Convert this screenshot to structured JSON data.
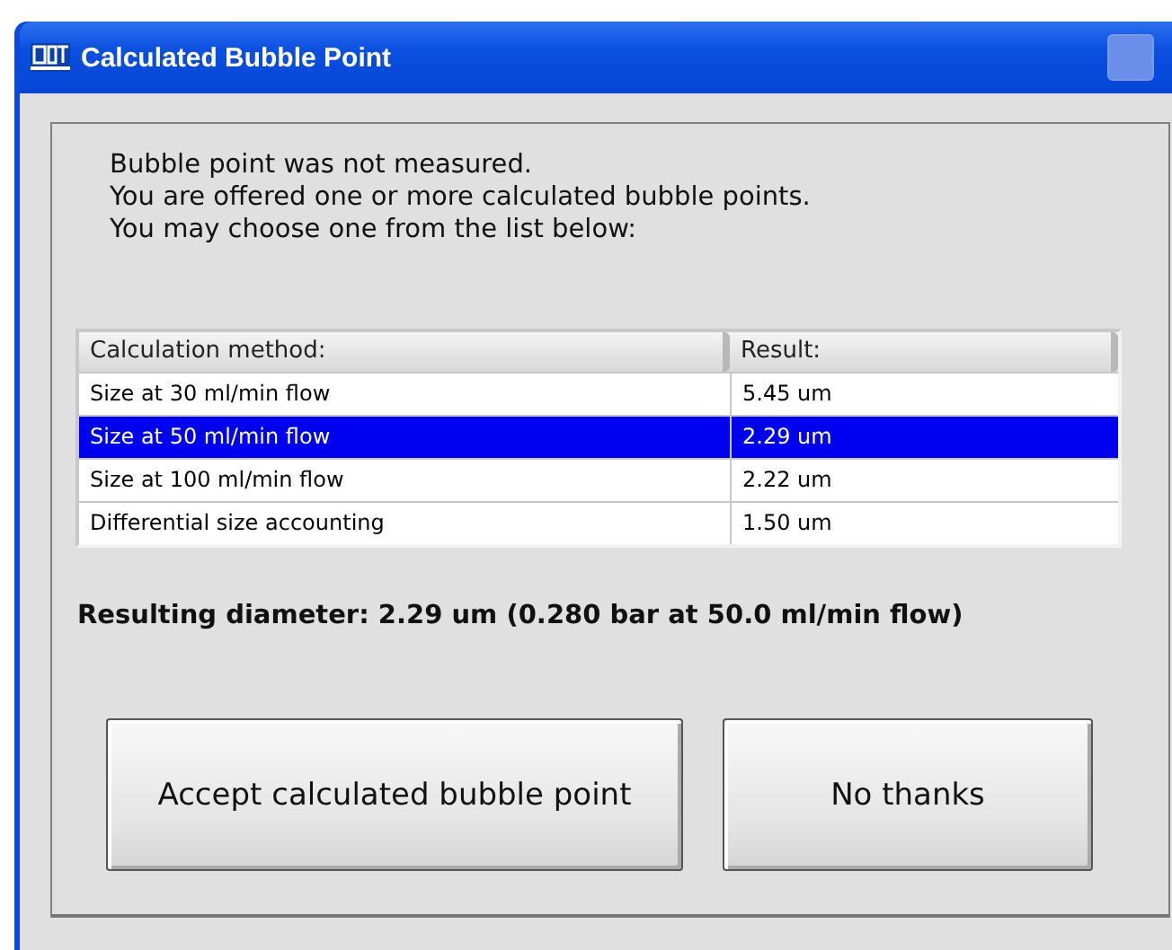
{
  "window": {
    "title": "Calculated Bubble Point"
  },
  "message": [
    "Bubble point was not measured.",
    "You are offered one or more calculated bubble points.",
    "You may choose one from the list below:"
  ],
  "table": {
    "columns": [
      "Calculation method:",
      "Result:"
    ],
    "rows": [
      {
        "method": "Size at 30 ml/min flow",
        "result": "5.45 um",
        "selected": false
      },
      {
        "method": "Size at 50 ml/min flow",
        "result": "2.29 um",
        "selected": true
      },
      {
        "method": "Size at 100 ml/min flow",
        "result": "2.22 um",
        "selected": false
      },
      {
        "method": "Differential size accounting",
        "result": "1.50 um",
        "selected": false
      }
    ]
  },
  "result_text": "Resulting diameter: 2.29 um (0.280 bar at 50.0 ml/min flow)",
  "buttons": [
    "Accept calculated bubble point",
    "No thanks"
  ]
}
